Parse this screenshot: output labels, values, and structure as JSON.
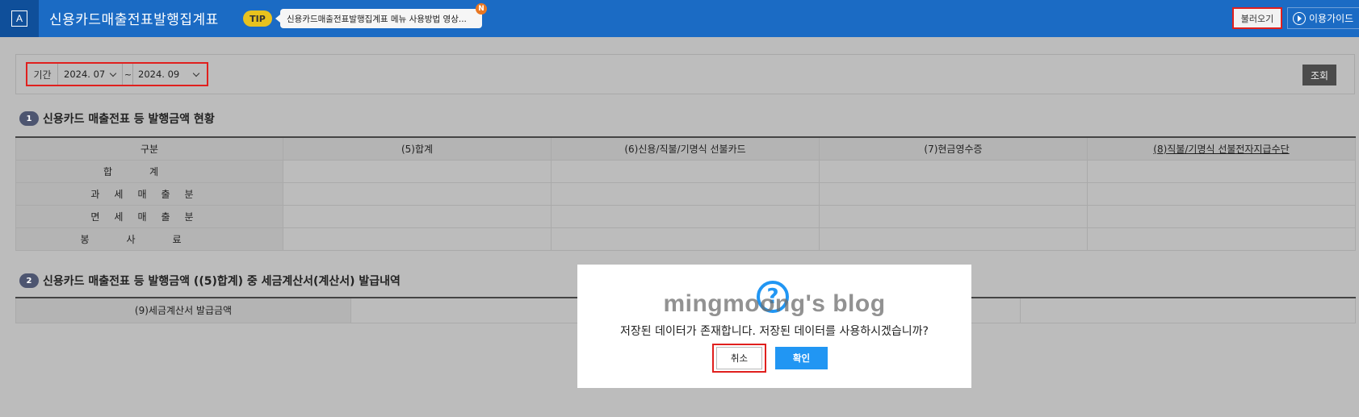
{
  "header": {
    "app_icon": "A",
    "title": "신용카드매출전표발행집계표",
    "tip_label": "TIP",
    "tip_text": "신용카드매출전표발행집계표 메뉴 사용방법 영상...",
    "new_badge": "N",
    "load_button": "불러오기",
    "guide_button": "이용가이드"
  },
  "filter": {
    "period_label": "기간",
    "start": "2024. 07",
    "separator": "~",
    "end": "2024. 09",
    "query_button": "조회"
  },
  "section1": {
    "number": "1",
    "title": "신용카드 매출전표 등 발행금액 현황",
    "columns": [
      "구분",
      "(5)합계",
      "(6)신용/직불/기명식 선불카드",
      "(7)현금영수증",
      "(8)직불/기명식 선불전자지급수단"
    ],
    "rows": [
      "합계",
      "과세매출분",
      "면세매출분",
      "봉사료"
    ]
  },
  "section2": {
    "number": "2",
    "title": "신용카드 매출전표 등 발행금액 ((5)합계) 중 세금계산서(계산서) 발급내역",
    "columns": [
      "(9)세금계산서 발급금액"
    ]
  },
  "modal": {
    "icon": "?",
    "watermark": "mingmoong's blog",
    "message": "저장된 데이터가 존재합니다. 저장된 데이터를 사용하시겠습니까?",
    "cancel_button": "취소",
    "ok_button": "확인"
  },
  "colors": {
    "header_bg": "#1b6bc4",
    "highlight": "#e0201e",
    "primary": "#2196f3"
  }
}
